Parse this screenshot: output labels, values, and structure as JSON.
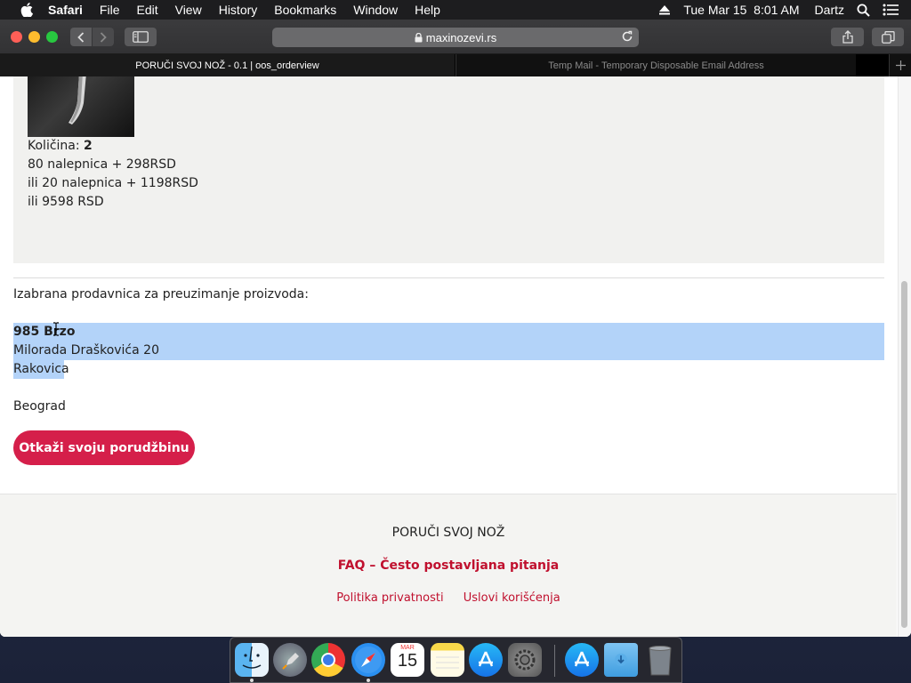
{
  "menubar": {
    "app_name": "Safari",
    "menus": [
      "File",
      "Edit",
      "View",
      "History",
      "Bookmarks",
      "Window",
      "Help"
    ],
    "clock": "Tue Mar 15  8:01 AM",
    "user": "Dartz",
    "icons": [
      "apple-icon",
      "eject-icon",
      "spotlight-search-icon",
      "notification-list-icon"
    ]
  },
  "toolbar": {
    "url": "maxinozevi.rs"
  },
  "tabs": [
    {
      "title": "PORUČI SVOJ NOŽ - 0.1 | oos_orderview",
      "active": true
    },
    {
      "title": "Temp Mail - Temporary Disposable Email Address",
      "active": false
    }
  ],
  "order": {
    "quantity_label": "Količina: ",
    "quantity_value": "2",
    "price_line_1": "80 nalepnica + 298RSD",
    "price_line_2": "ili 20 nalepnica + 1198RSD",
    "price_line_3": "ili 9598 RSD"
  },
  "store": {
    "heading": "Izabrana prodavnica za preuzimanje proizvoda:",
    "name": "985 Brzo",
    "street": "Milorada Draškovića 20",
    "district": "Rakovica",
    "city": "Beograd"
  },
  "cancel_button": "Otkaži svoju porudžbinu",
  "footer": {
    "title": "PORUČI SVOJ NOŽ",
    "faq": "FAQ – Često postavljana pitanja",
    "privacy": "Politika privatnosti",
    "terms": "Uslovi korišćenja"
  },
  "dock": {
    "apps": [
      "Finder",
      "Launchpad",
      "Google Chrome",
      "Safari",
      "Calendar",
      "Notes",
      "App Store",
      "System Preferences",
      "App Store Downloads",
      "Downloads Folder",
      "Trash"
    ],
    "calendar_month": "MAR",
    "calendar_day": "15"
  },
  "colors": {
    "accent_red": "#d51f4a",
    "link_red": "#c0102e",
    "selection_blue": "#b3d3f9"
  }
}
